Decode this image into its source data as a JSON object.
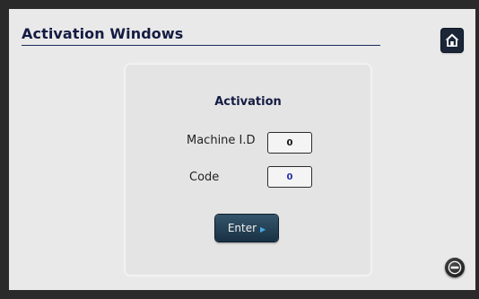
{
  "header": {
    "title": "Activation Windows",
    "home_icon": "home-icon"
  },
  "activation": {
    "title": "Activation",
    "machine_id_label": "Machine I.D",
    "machine_id_value": "0",
    "code_label": "Code",
    "code_value": "0",
    "enter_label": "Enter",
    "enter_icon": "play-arrow-icon"
  },
  "footer": {
    "back_icon": "back-icon"
  },
  "colors": {
    "title_text": "#141b42",
    "code_value": "#2431a8",
    "enter_button": "#1a3144",
    "enter_arrow": "#47a8e8"
  }
}
